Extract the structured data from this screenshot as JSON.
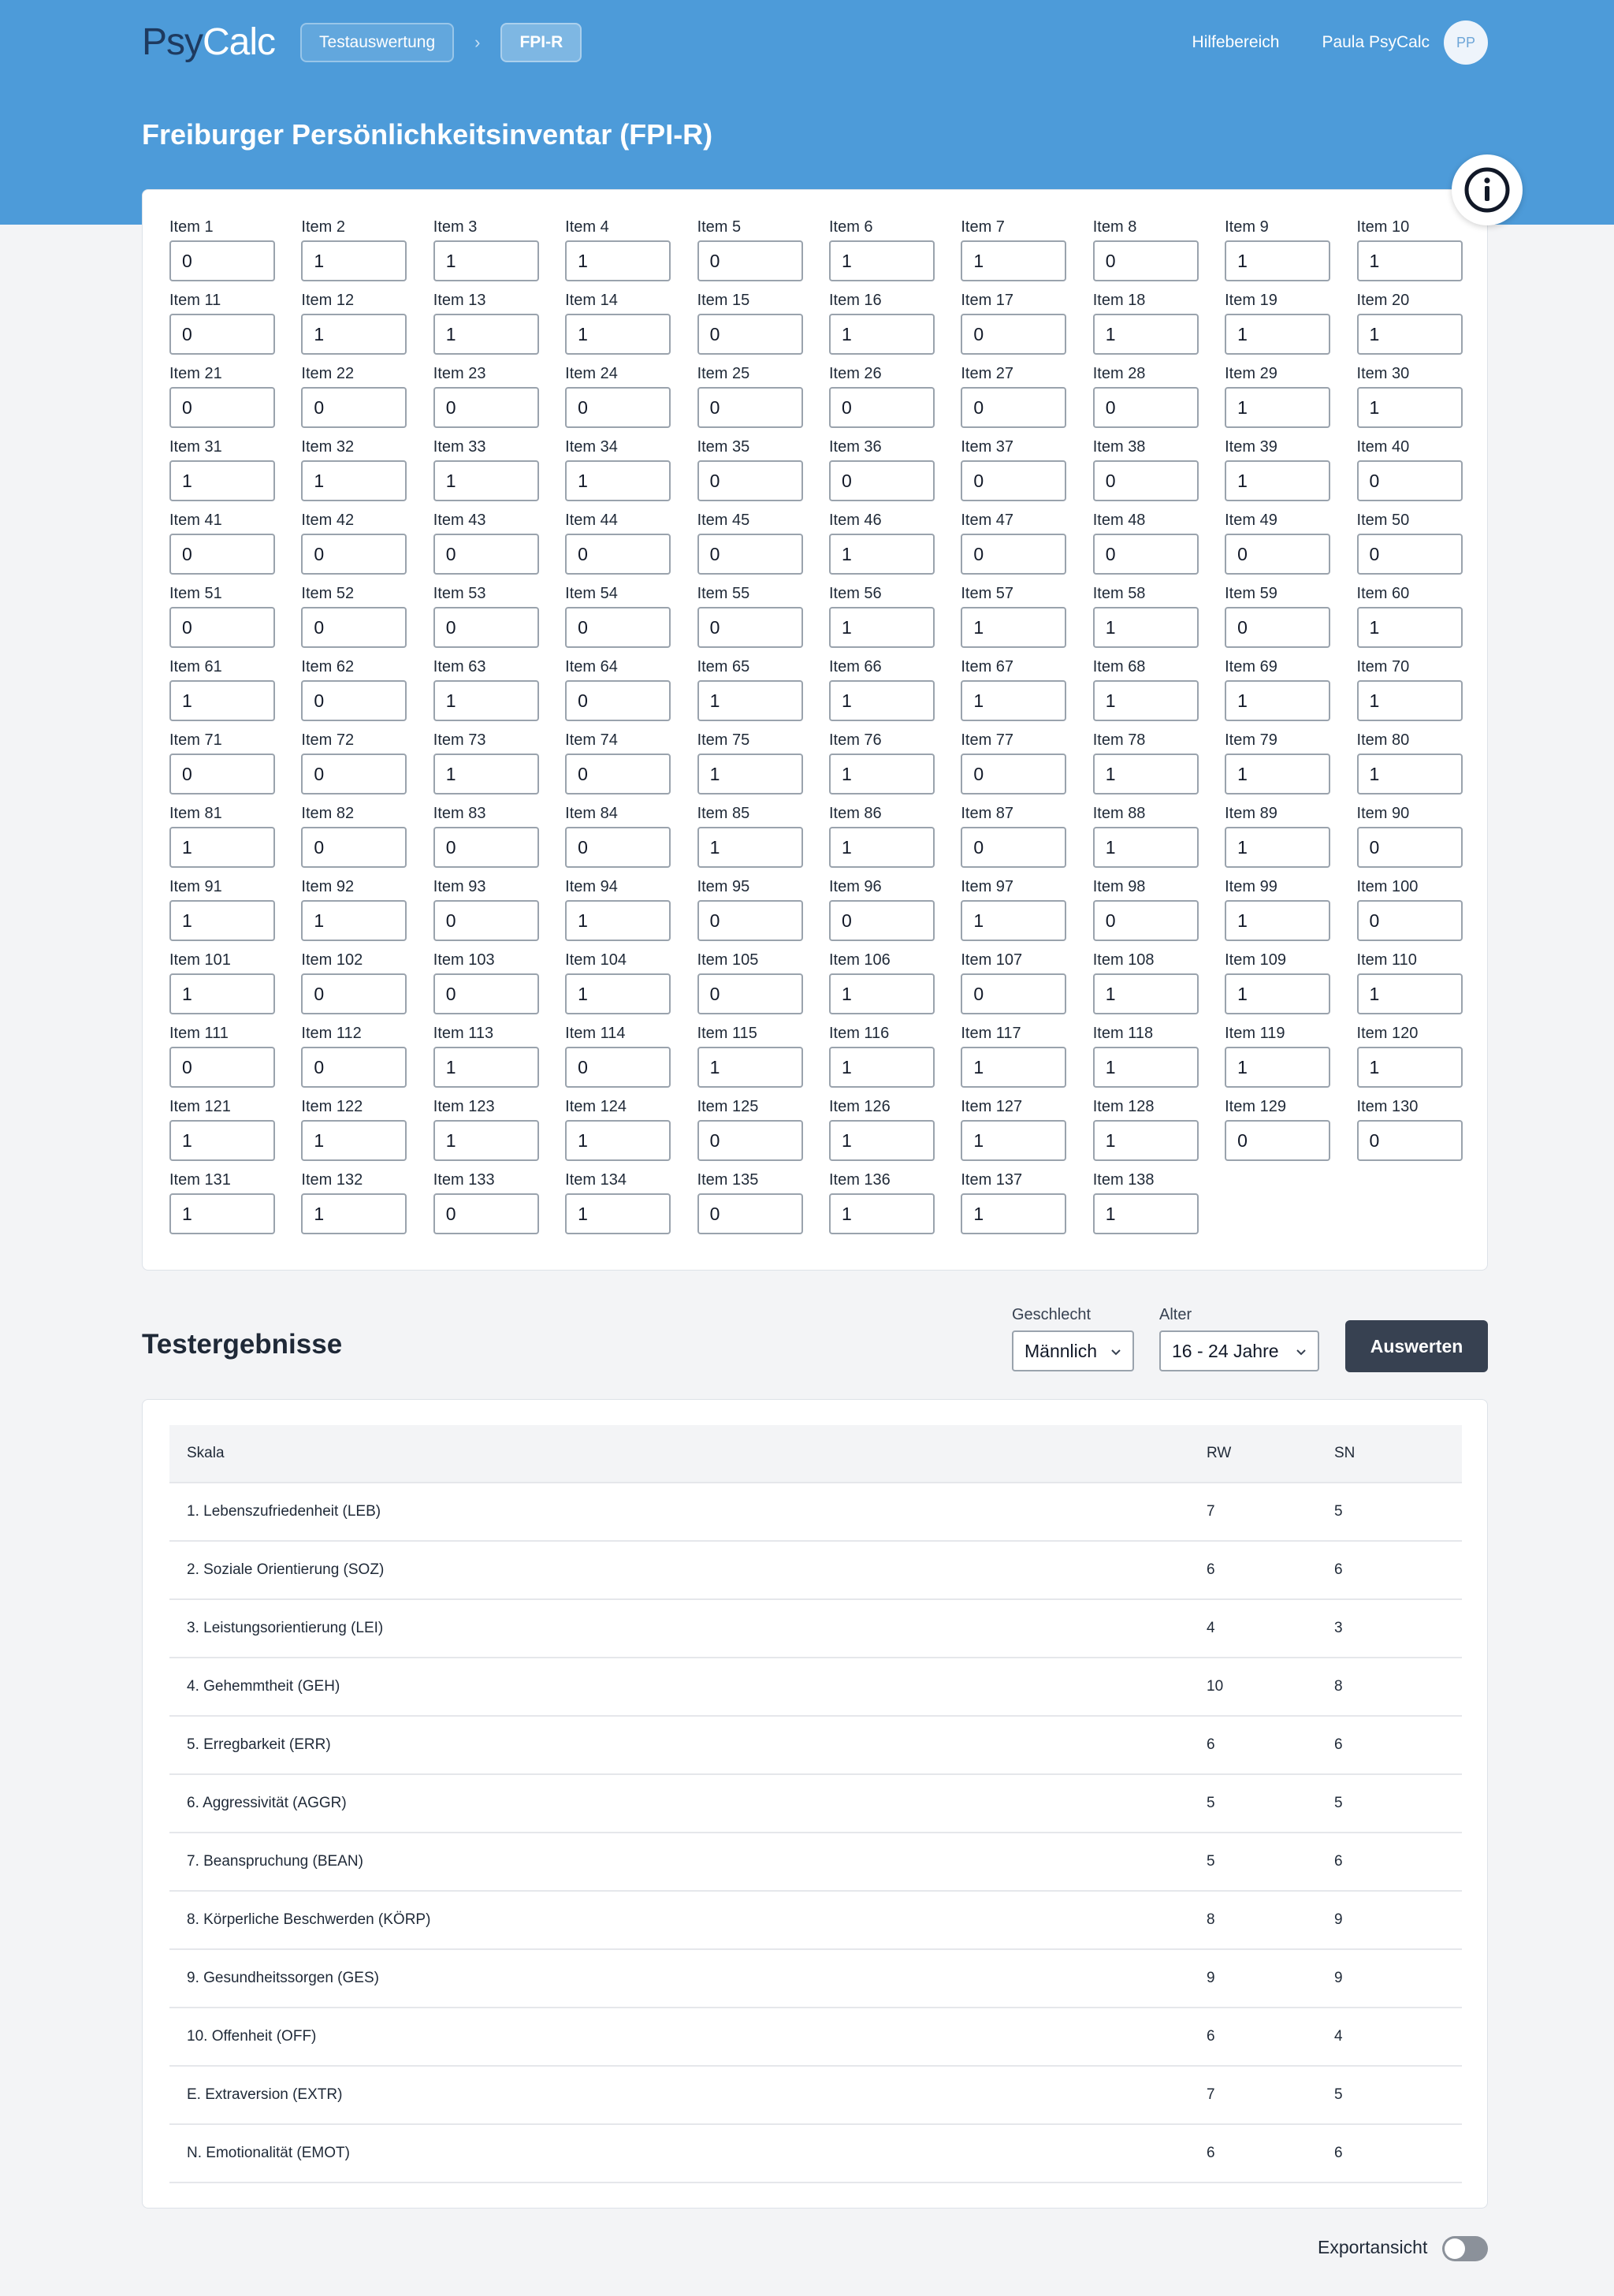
{
  "header": {
    "logo_part1": "Psy",
    "logo_part2": "Calc",
    "breadcrumbs": [
      "Testauswertung",
      "FPI-R"
    ],
    "breadcrumb_separator": "›",
    "help_link": "Hilfebereich",
    "user_name": "Paula PsyCalc",
    "avatar_initials": "PP"
  },
  "page_title": "Freiburger Persönlichkeitsinventar (FPI-R)",
  "info_icon": "info-circle-icon",
  "items": [
    {
      "label": "Item 1",
      "value": "0"
    },
    {
      "label": "Item 2",
      "value": "1"
    },
    {
      "label": "Item 3",
      "value": "1"
    },
    {
      "label": "Item 4",
      "value": "1"
    },
    {
      "label": "Item 5",
      "value": "0"
    },
    {
      "label": "Item 6",
      "value": "1"
    },
    {
      "label": "Item 7",
      "value": "1"
    },
    {
      "label": "Item 8",
      "value": "0"
    },
    {
      "label": "Item 9",
      "value": "1"
    },
    {
      "label": "Item 10",
      "value": "1"
    },
    {
      "label": "Item 11",
      "value": "0"
    },
    {
      "label": "Item 12",
      "value": "1"
    },
    {
      "label": "Item 13",
      "value": "1"
    },
    {
      "label": "Item 14",
      "value": "1"
    },
    {
      "label": "Item 15",
      "value": "0"
    },
    {
      "label": "Item 16",
      "value": "1"
    },
    {
      "label": "Item 17",
      "value": "0"
    },
    {
      "label": "Item 18",
      "value": "1"
    },
    {
      "label": "Item 19",
      "value": "1"
    },
    {
      "label": "Item 20",
      "value": "1"
    },
    {
      "label": "Item 21",
      "value": "0"
    },
    {
      "label": "Item 22",
      "value": "0"
    },
    {
      "label": "Item 23",
      "value": "0"
    },
    {
      "label": "Item 24",
      "value": "0"
    },
    {
      "label": "Item 25",
      "value": "0"
    },
    {
      "label": "Item 26",
      "value": "0"
    },
    {
      "label": "Item 27",
      "value": "0"
    },
    {
      "label": "Item 28",
      "value": "0"
    },
    {
      "label": "Item 29",
      "value": "1"
    },
    {
      "label": "Item 30",
      "value": "1"
    },
    {
      "label": "Item 31",
      "value": "1"
    },
    {
      "label": "Item 32",
      "value": "1"
    },
    {
      "label": "Item 33",
      "value": "1"
    },
    {
      "label": "Item 34",
      "value": "1"
    },
    {
      "label": "Item 35",
      "value": "0"
    },
    {
      "label": "Item 36",
      "value": "0"
    },
    {
      "label": "Item 37",
      "value": "0"
    },
    {
      "label": "Item 38",
      "value": "0"
    },
    {
      "label": "Item 39",
      "value": "1"
    },
    {
      "label": "Item 40",
      "value": "0"
    },
    {
      "label": "Item 41",
      "value": "0"
    },
    {
      "label": "Item 42",
      "value": "0"
    },
    {
      "label": "Item 43",
      "value": "0"
    },
    {
      "label": "Item 44",
      "value": "0"
    },
    {
      "label": "Item 45",
      "value": "0"
    },
    {
      "label": "Item 46",
      "value": "1"
    },
    {
      "label": "Item 47",
      "value": "0"
    },
    {
      "label": "Item 48",
      "value": "0"
    },
    {
      "label": "Item 49",
      "value": "0"
    },
    {
      "label": "Item 50",
      "value": "0"
    },
    {
      "label": "Item 51",
      "value": "0"
    },
    {
      "label": "Item 52",
      "value": "0"
    },
    {
      "label": "Item 53",
      "value": "0"
    },
    {
      "label": "Item 54",
      "value": "0"
    },
    {
      "label": "Item 55",
      "value": "0"
    },
    {
      "label": "Item 56",
      "value": "1"
    },
    {
      "label": "Item 57",
      "value": "1"
    },
    {
      "label": "Item 58",
      "value": "1"
    },
    {
      "label": "Item 59",
      "value": "0"
    },
    {
      "label": "Item 60",
      "value": "1"
    },
    {
      "label": "Item 61",
      "value": "1"
    },
    {
      "label": "Item 62",
      "value": "0"
    },
    {
      "label": "Item 63",
      "value": "1"
    },
    {
      "label": "Item 64",
      "value": "0"
    },
    {
      "label": "Item 65",
      "value": "1"
    },
    {
      "label": "Item 66",
      "value": "1"
    },
    {
      "label": "Item 67",
      "value": "1"
    },
    {
      "label": "Item 68",
      "value": "1"
    },
    {
      "label": "Item 69",
      "value": "1"
    },
    {
      "label": "Item 70",
      "value": "1"
    },
    {
      "label": "Item 71",
      "value": "0"
    },
    {
      "label": "Item 72",
      "value": "0"
    },
    {
      "label": "Item 73",
      "value": "1"
    },
    {
      "label": "Item 74",
      "value": "0"
    },
    {
      "label": "Item 75",
      "value": "1"
    },
    {
      "label": "Item 76",
      "value": "1"
    },
    {
      "label": "Item 77",
      "value": "0"
    },
    {
      "label": "Item 78",
      "value": "1"
    },
    {
      "label": "Item 79",
      "value": "1"
    },
    {
      "label": "Item 80",
      "value": "1"
    },
    {
      "label": "Item 81",
      "value": "1"
    },
    {
      "label": "Item 82",
      "value": "0"
    },
    {
      "label": "Item 83",
      "value": "0"
    },
    {
      "label": "Item 84",
      "value": "0"
    },
    {
      "label": "Item 85",
      "value": "1"
    },
    {
      "label": "Item 86",
      "value": "1"
    },
    {
      "label": "Item 87",
      "value": "0"
    },
    {
      "label": "Item 88",
      "value": "1"
    },
    {
      "label": "Item 89",
      "value": "1"
    },
    {
      "label": "Item 90",
      "value": "0"
    },
    {
      "label": "Item 91",
      "value": "1"
    },
    {
      "label": "Item 92",
      "value": "1"
    },
    {
      "label": "Item 93",
      "value": "0"
    },
    {
      "label": "Item 94",
      "value": "1"
    },
    {
      "label": "Item 95",
      "value": "0"
    },
    {
      "label": "Item 96",
      "value": "0"
    },
    {
      "label": "Item 97",
      "value": "1"
    },
    {
      "label": "Item 98",
      "value": "0"
    },
    {
      "label": "Item 99",
      "value": "1"
    },
    {
      "label": "Item 100",
      "value": "0"
    },
    {
      "label": "Item 101",
      "value": "1"
    },
    {
      "label": "Item 102",
      "value": "0"
    },
    {
      "label": "Item 103",
      "value": "0"
    },
    {
      "label": "Item 104",
      "value": "1"
    },
    {
      "label": "Item 105",
      "value": "0"
    },
    {
      "label": "Item 106",
      "value": "1"
    },
    {
      "label": "Item 107",
      "value": "0"
    },
    {
      "label": "Item 108",
      "value": "1"
    },
    {
      "label": "Item 109",
      "value": "1"
    },
    {
      "label": "Item 110",
      "value": "1"
    },
    {
      "label": "Item 111",
      "value": "0"
    },
    {
      "label": "Item 112",
      "value": "0"
    },
    {
      "label": "Item 113",
      "value": "1"
    },
    {
      "label": "Item 114",
      "value": "0"
    },
    {
      "label": "Item 115",
      "value": "1"
    },
    {
      "label": "Item 116",
      "value": "1"
    },
    {
      "label": "Item 117",
      "value": "1"
    },
    {
      "label": "Item 118",
      "value": "1"
    },
    {
      "label": "Item 119",
      "value": "1"
    },
    {
      "label": "Item 120",
      "value": "1"
    },
    {
      "label": "Item 121",
      "value": "1"
    },
    {
      "label": "Item 122",
      "value": "1"
    },
    {
      "label": "Item 123",
      "value": "1"
    },
    {
      "label": "Item 124",
      "value": "1"
    },
    {
      "label": "Item 125",
      "value": "0"
    },
    {
      "label": "Item 126",
      "value": "1"
    },
    {
      "label": "Item 127",
      "value": "1"
    },
    {
      "label": "Item 128",
      "value": "1"
    },
    {
      "label": "Item 129",
      "value": "0"
    },
    {
      "label": "Item 130",
      "value": "0"
    },
    {
      "label": "Item 131",
      "value": "1"
    },
    {
      "label": "Item 132",
      "value": "1"
    },
    {
      "label": "Item 133",
      "value": "0"
    },
    {
      "label": "Item 134",
      "value": "1"
    },
    {
      "label": "Item 135",
      "value": "0"
    },
    {
      "label": "Item 136",
      "value": "1"
    },
    {
      "label": "Item 137",
      "value": "1"
    },
    {
      "label": "Item 138",
      "value": "1"
    }
  ],
  "results": {
    "title": "Testergebnisse",
    "gender_label": "Geschlecht",
    "gender_value": "Männlich",
    "age_label": "Alter",
    "age_value": "16 - 24 Jahre",
    "evaluate_button": "Auswerten",
    "columns": [
      "Skala",
      "RW",
      "SN"
    ],
    "rows": [
      {
        "scale": "1. Lebenszufriedenheit (LEB)",
        "rw": "7",
        "sn": "5"
      },
      {
        "scale": "2. Soziale Orientierung (SOZ)",
        "rw": "6",
        "sn": "6"
      },
      {
        "scale": "3. Leistungsorientierung (LEI)",
        "rw": "4",
        "sn": "3"
      },
      {
        "scale": "4. Gehemmtheit (GEH)",
        "rw": "10",
        "sn": "8"
      },
      {
        "scale": "5. Erregbarkeit (ERR)",
        "rw": "6",
        "sn": "6"
      },
      {
        "scale": "6. Aggressivität (AGGR)",
        "rw": "5",
        "sn": "5"
      },
      {
        "scale": "7. Beanspruchung (BEAN)",
        "rw": "5",
        "sn": "6"
      },
      {
        "scale": "8. Körperliche Beschwerden (KÖRP)",
        "rw": "8",
        "sn": "9"
      },
      {
        "scale": "9. Gesundheitssorgen (GES)",
        "rw": "9",
        "sn": "9"
      },
      {
        "scale": "10. Offenheit (OFF)",
        "rw": "6",
        "sn": "4"
      },
      {
        "scale": "E. Extraversion (EXTR)",
        "rw": "7",
        "sn": "5"
      },
      {
        "scale": "N. Emotionalität (EMOT)",
        "rw": "6",
        "sn": "6"
      }
    ]
  },
  "export_toggle": {
    "label": "Exportansicht",
    "enabled": false
  },
  "colors": {
    "header_blue": "#4d9bd9",
    "button_dark": "#374151",
    "logo_dark": "#1e3a5f"
  }
}
